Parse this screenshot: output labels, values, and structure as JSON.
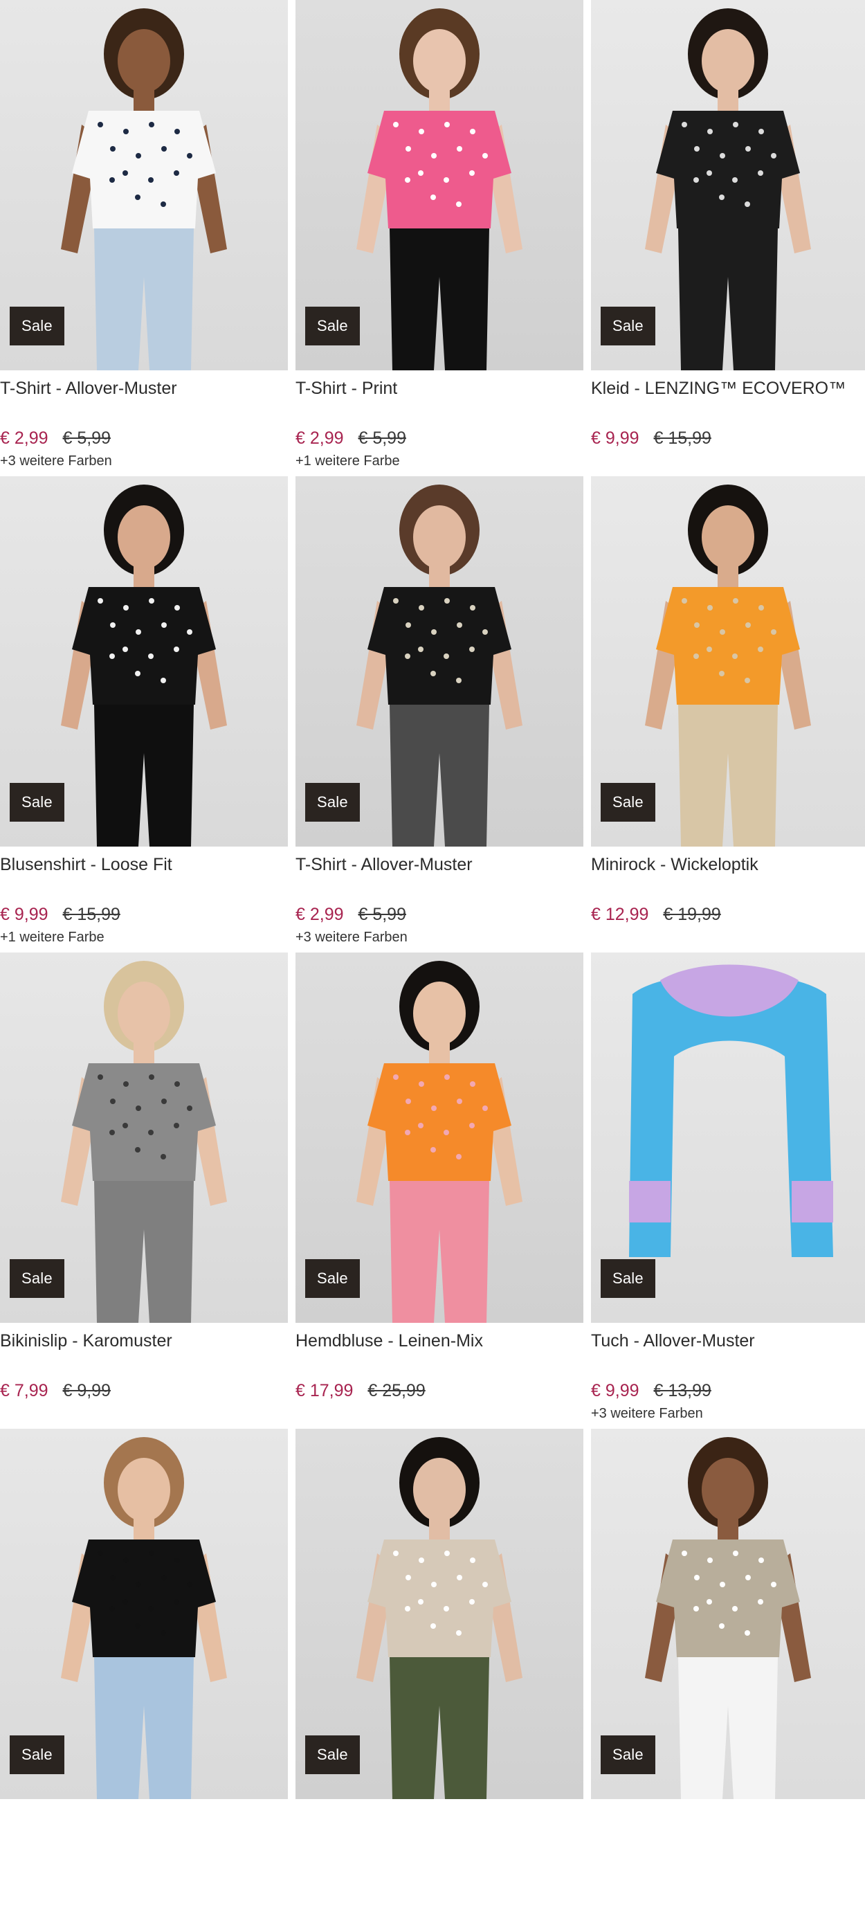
{
  "products": [
    {
      "title": "T-Shirt - Allover-Muster",
      "price_new": "€ 2,99",
      "price_old": "€ 5,99",
      "badge": "Sale",
      "colors": "+3 weitere Farben",
      "garment": "#f7f7f7",
      "garment_accent": "#1d2a44",
      "bottom": "#b9cde0",
      "skin": "#8a5a3c",
      "hair": "#3b2617"
    },
    {
      "title": "T-Shirt - Print",
      "price_new": "€ 2,99",
      "price_old": "€ 5,99",
      "badge": "Sale",
      "colors": "+1 weitere Farbe",
      "garment": "#ee5b8d",
      "garment_accent": "#ffffff",
      "bottom": "#111111",
      "skin": "#e8c4ae",
      "hair": "#5a3a24"
    },
    {
      "title": "Kleid - LENZING™ ECOVERO™",
      "price_new": "€ 9,99",
      "price_old": "€ 15,99",
      "badge": "Sale",
      "colors": "",
      "garment": "#1c1c1c",
      "garment_accent": "#dcdcdc",
      "bottom": "#1c1c1c",
      "skin": "#e3bda4",
      "hair": "#1f1712"
    },
    {
      "title": "Blusenshirt - Loose Fit",
      "price_new": "€ 9,99",
      "price_old": "€ 15,99",
      "badge": "Sale",
      "colors": "+1 weitere Farbe",
      "garment": "#141414",
      "garment_accent": "#f1f1f1",
      "bottom": "#0f0f0f",
      "skin": "#d8a98c",
      "hair": "#151210"
    },
    {
      "title": "T-Shirt - Allover-Muster",
      "price_new": "€ 2,99",
      "price_old": "€ 5,99",
      "badge": "Sale",
      "colors": "+3 weitere Farben",
      "garment": "#161616",
      "garment_accent": "#d9d2c0",
      "bottom": "#4b4b4b",
      "skin": "#e1b9a0",
      "hair": "#5a3b2a"
    },
    {
      "title": "Minirock - Wickeloptik",
      "price_new": "€ 12,99",
      "price_old": "€ 19,99",
      "badge": "Sale",
      "colors": "",
      "garment": "#f39a2a",
      "garment_accent": "#d8c6a6",
      "bottom": "#d8c6a6",
      "skin": "#d9ab8c",
      "hair": "#16120f"
    },
    {
      "title": "Bikinislip - Karomuster",
      "price_new": "€ 7,99",
      "price_old": "€ 9,99",
      "badge": "Sale",
      "colors": "",
      "garment": "#8a8a8a",
      "garment_accent": "#3a3a3a",
      "bottom": "#7f7f7f",
      "skin": "#e7c2a8",
      "hair": "#d8c39c"
    },
    {
      "title": "Hemdbluse - Leinen-Mix",
      "price_new": "€ 17,99",
      "price_old": "€ 25,99",
      "badge": "Sale",
      "colors": "",
      "garment": "#f58a2a",
      "garment_accent": "#f2a8b3",
      "bottom": "#ef8fa0",
      "skin": "#e7c1a6",
      "hair": "#14110f"
    },
    {
      "title": "Tuch - Allover-Muster",
      "price_new": "€ 9,99",
      "price_old": "€ 13,99",
      "badge": "Sale",
      "colors": "+3 weitere Farben",
      "garment": "#49b4e6",
      "garment_accent": "#c7a6e4",
      "bottom": "#49b4e6",
      "skin": "#ffffff",
      "hair": "#ffffff"
    },
    {
      "title": "",
      "price_new": "",
      "price_old": "",
      "badge": "Sale",
      "colors": "",
      "garment": "#121212",
      "garment_accent": "#111111",
      "bottom": "#a9c4de",
      "skin": "#e6bfa3",
      "hair": "#a4764f"
    },
    {
      "title": "",
      "price_new": "",
      "price_old": "",
      "badge": "Sale",
      "colors": "",
      "garment": "#d6c9b8",
      "garment_accent": "#ffffff",
      "bottom": "#4c5a3a",
      "skin": "#e1bda5",
      "hair": "#15110e"
    },
    {
      "title": "",
      "price_new": "",
      "price_old": "",
      "badge": "Sale",
      "colors": "",
      "garment": "#b8ae9b",
      "garment_accent": "#ffffff",
      "bottom": "#f4f4f4",
      "skin": "#8a5b3f",
      "hair": "#3b2415"
    }
  ]
}
